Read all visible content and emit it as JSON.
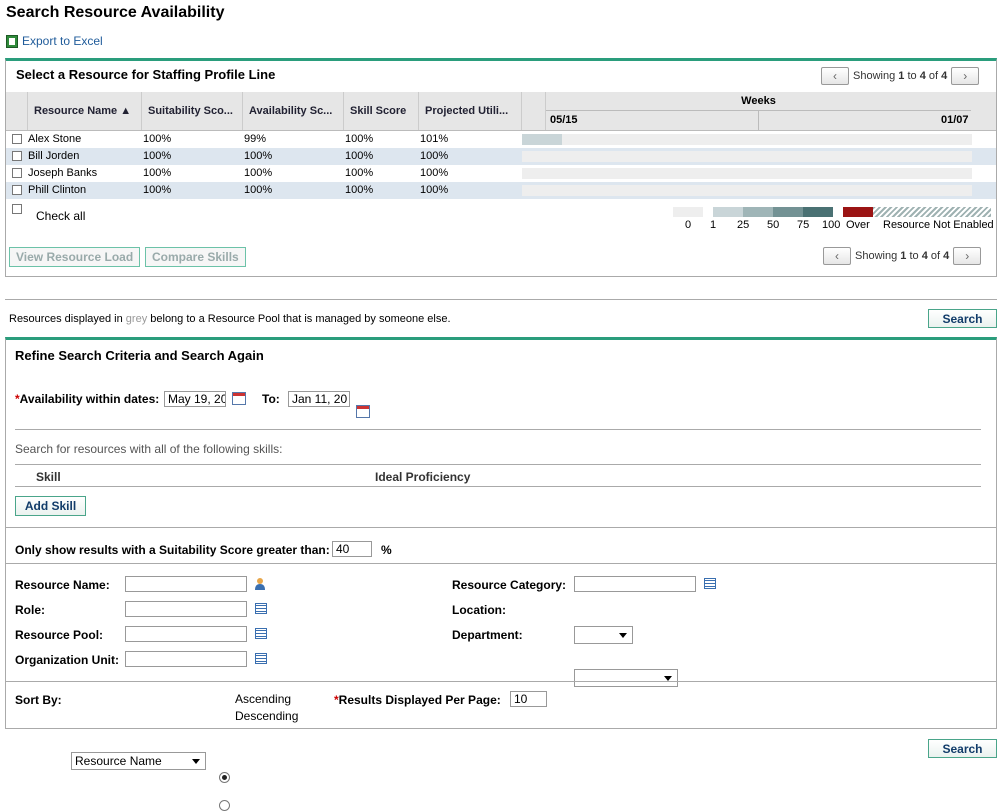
{
  "page_title": "Search Resource Availability",
  "export_label": "Export to Excel",
  "results_panel": {
    "title": "Select a Resource for Staffing Profile Line",
    "pager_top": {
      "prefix": "Showing ",
      "from": "1",
      "mid": " to ",
      "to": "4",
      "of": " of ",
      "total": "4"
    },
    "pager_bottom": {
      "prefix": "Showing ",
      "from": "1",
      "mid": " to ",
      "to": "4",
      "of": " of ",
      "total": "4"
    },
    "columns": [
      "Resource Name ▲",
      "Suitability Sco...",
      "Availability Sc...",
      "Skill Score",
      "Projected Utili..."
    ],
    "weeks_label": "Weeks",
    "week_start": "05/15",
    "week_end": "01/07",
    "rows": [
      {
        "name": "Alex Stone",
        "suitability": "100%",
        "availability": "99%",
        "skill": "100%",
        "projected": "101%"
      },
      {
        "name": "Bill Jorden",
        "suitability": "100%",
        "availability": "100%",
        "skill": "100%",
        "projected": "100%"
      },
      {
        "name": "Joseph Banks",
        "suitability": "100%",
        "availability": "100%",
        "skill": "100%",
        "projected": "100%"
      },
      {
        "name": "Phill Clinton",
        "suitability": "100%",
        "availability": "100%",
        "skill": "100%",
        "projected": "100%"
      }
    ],
    "check_all": "Check all",
    "legend": {
      "l0": "0",
      "l1": "1",
      "l25": "25",
      "l50": "50",
      "l75": "75",
      "l100": "100",
      "over": "Over",
      "not_enabled": "Resource Not Enabled"
    },
    "legend_colors": [
      "#eeeeee",
      "#c9d5d8",
      "#9fb5b7",
      "#739294",
      "#4a7173",
      "#234a4d",
      "#9b1414"
    ],
    "view_resource_load": "View Resource Load",
    "compare_skills": "Compare Skills"
  },
  "grey_note": {
    "before": "Resources displayed in ",
    "grey": "grey",
    "after": " belong to a Resource Pool that is managed by someone else."
  },
  "search_label": "Search",
  "refine_panel": {
    "title": "Refine Search Criteria and Search Again",
    "availability_label": "Availability within dates:",
    "from_date": "May 19, 20",
    "to_label": "To:",
    "to_date": "Jan 11, 20",
    "skills_note": "Search for resources with all of the following skills:",
    "skill_col": "Skill",
    "proficiency_col": "Ideal Proficiency",
    "add_skill": "Add Skill",
    "suitability_label": "Only show results with a Suitability Score greater than:",
    "suitability_value": "40",
    "percent": "%",
    "resource_name_label": "Resource Name:",
    "role_label": "Role:",
    "resource_pool_label": "Resource Pool:",
    "org_unit_label": "Organization Unit:",
    "resource_category_label": "Resource Category:",
    "location_label": "Location:",
    "department_label": "Department:",
    "sort_by_label": "Sort By:",
    "sort_by_value": "Resource Name",
    "ascending": "Ascending",
    "descending": "Descending",
    "per_page_label": "Results Displayed Per Page:",
    "per_page_value": "10"
  }
}
